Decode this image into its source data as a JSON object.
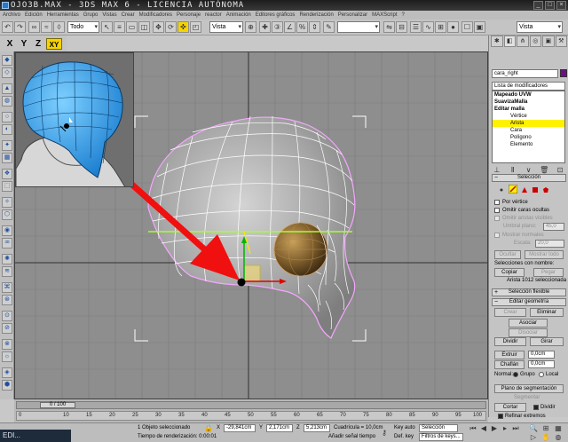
{
  "window": {
    "title": "OJO3B.MAX - 3DS MAX 6 - LICENCIA AUTÓNOMA",
    "buttons": [
      "_",
      "□",
      "×"
    ]
  },
  "menu": [
    "Archivo",
    "Edición",
    "Herramientas",
    "Grupo",
    "Vistas",
    "Crear",
    "Modificadores",
    "Personaje",
    "reactor",
    "Animación",
    "Editores gráficos",
    "Renderización",
    "Personalizar",
    "MAXScript",
    "?"
  ],
  "toolbar": {
    "selection_filter": "Todo",
    "reference_coord": "Vista",
    "named_selection": "Vista"
  },
  "axis_constraints": [
    "X",
    "Y",
    "Z",
    "XY"
  ],
  "viewport": {
    "name": ""
  },
  "command_panel": {
    "object_name": "cara_right",
    "modifier_list": "Lista de modificadores",
    "stack": [
      {
        "label": "Mapeado UVW",
        "bold": true,
        "sub": false,
        "selected": false
      },
      {
        "label": "SuavizaMalla",
        "bold": true,
        "sub": false,
        "selected": false
      },
      {
        "label": "Editar malla",
        "bold": true,
        "sub": false,
        "selected": false
      },
      {
        "label": "Vértice",
        "bold": false,
        "sub": true,
        "selected": false
      },
      {
        "label": "Arista",
        "bold": false,
        "sub": true,
        "selected": true
      },
      {
        "label": "Cara",
        "bold": false,
        "sub": true,
        "selected": false
      },
      {
        "label": "Polígono",
        "bold": false,
        "sub": true,
        "selected": false
      },
      {
        "label": "Elemento",
        "bold": false,
        "sub": true,
        "selected": false
      }
    ],
    "rollout_selection": "Selección",
    "by_vertex": "Por vértice",
    "ignore_backfacing": "Omitir caras ocultas",
    "ignore_visible_edges": "Omitir aristas visibles",
    "planar_threshold_label": "Umbral plano:",
    "planar_threshold": "45,0",
    "show_normals": "Mostrar normales",
    "scale_label": "Escala:",
    "scale": "20,0",
    "hide_button": "Ocultar",
    "unhide_button": "Mostrar todo",
    "named_selections": "Selecciones con nombre:",
    "copy_button": "Copiar",
    "paste_button": "Pegar",
    "selection_status": "Arista 1012 seleccionada",
    "rollout_soft": "Selección flexible",
    "rollout_geometry": "Editar geometría",
    "create_button": "Crear",
    "delete_button": "Eliminar",
    "attach_button": "Asociar",
    "detach_button": "Disociar",
    "divide_button": "Dividir",
    "turn_button": "Girar",
    "extrude_button": "Extruir",
    "extrude_value": "0,0cm",
    "chamfer_button": "Chaflán",
    "chamfer_value": "0,0cm",
    "normal_label": "Normal:",
    "group_label": "Grupo",
    "local_label": "Local",
    "slice_plane_button": "Plano de segmentación",
    "split_label": "Segmentar",
    "cut_button": "Cortar",
    "split_button": "Dividir",
    "refine_ends": "Refinar extremos"
  },
  "timeline": {
    "frame": "0 / 100",
    "ticks": [
      "0",
      "10",
      "15",
      "20",
      "25",
      "30",
      "35",
      "40",
      "45",
      "50",
      "55",
      "60",
      "65",
      "70",
      "75",
      "80",
      "85",
      "90",
      "95",
      "100"
    ]
  },
  "statusbar": {
    "selected": "1 Objeto seleccionado",
    "render_time": "Tiempo de renderización: 0:00:01",
    "x": "-29,841cm",
    "y": "2,171cm",
    "z": "5,213cm",
    "grid": "Cuadrícula = 10,0cm",
    "add_time_tag": "Añadir señal tiempo",
    "auto_key": "Key auto",
    "set_key": "Def. key",
    "key_mode": "Selección",
    "key_filters": "Filtros de keys...",
    "taskbar": "EDI..."
  },
  "colors": {
    "viewport_bg": "#8e8e8e",
    "arrow": "#f01010",
    "wire_highlight": "#f5a6ff",
    "selected_stack": "#fff200",
    "active_axis": "#f5d400",
    "object_color": "#6e0f86"
  }
}
